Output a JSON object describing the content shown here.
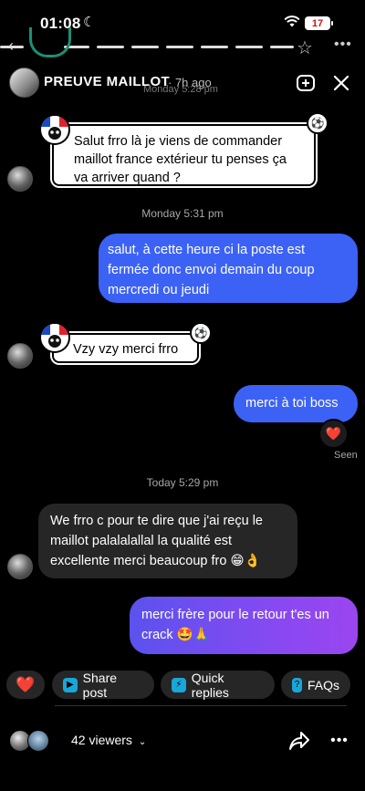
{
  "status_bar": {
    "time": "01:08",
    "battery": "17"
  },
  "header": {
    "title": "PREUVE MAILLOT",
    "subtitle": "· 7h ago",
    "ghost_stamp": "Monday 5:28 pm"
  },
  "messages": {
    "m1": {
      "text": "Salut frro là je viens de commander maillot france extérieur tu penses ça va arriver quand ?"
    },
    "stamp2": "Monday 5:31 pm",
    "m2": {
      "text": "salut, à cette heure ci la poste est fermée donc envoi demain du coup mercredi ou jeudi"
    },
    "m3": {
      "text": "Vzy vzy merci frro"
    },
    "m4": {
      "text": "merci à toi boss"
    },
    "m4_reaction": "❤️",
    "seen": "Seen",
    "stamp3": "Today 5:29 pm",
    "m5": {
      "text": "We frro c pour te dire que j'ai reçu le maillot palalalallal la qualité est excellente merci beaucoup fro 😁👌"
    },
    "m6": {
      "text": "merci frère pour le retour t'es un crack 🤩🙏"
    }
  },
  "chips": {
    "heart": "❤️",
    "share_post": "Share post",
    "quick_replies": "Quick replies",
    "faqs": "FAQs"
  },
  "footer": {
    "viewers": "42 viewers"
  },
  "colors": {
    "outgoing": "#3c62f5",
    "incoming": "#262626",
    "gradient_end": "#9b46ee",
    "chip_icon": "#19a6d8"
  }
}
